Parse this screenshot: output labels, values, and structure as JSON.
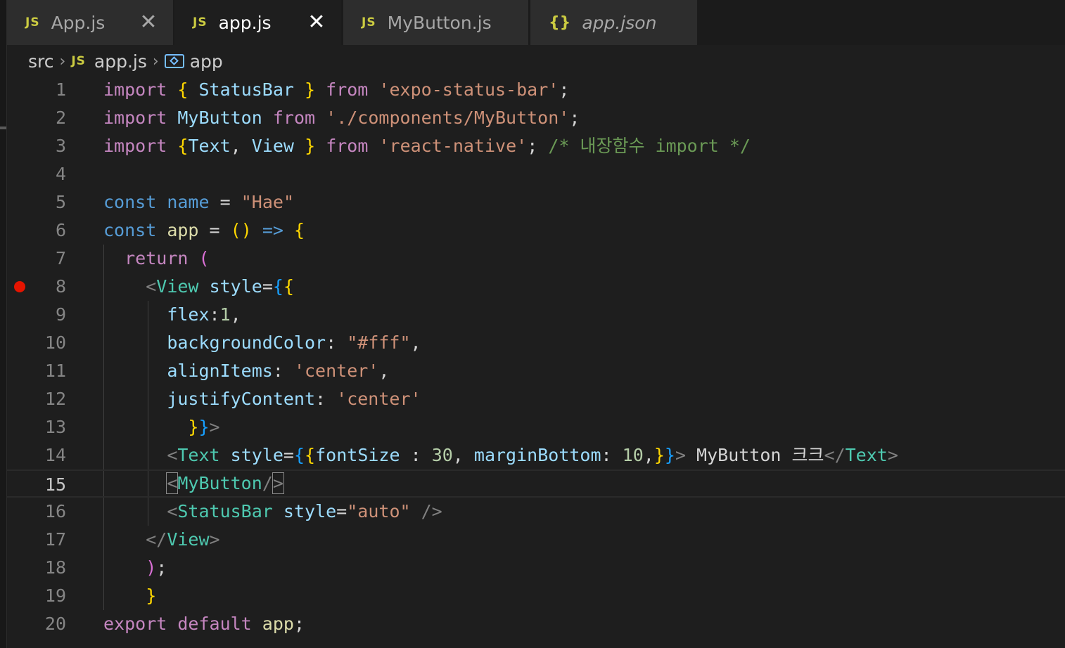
{
  "tabs": [
    {
      "icon": "JS",
      "label": "App.js",
      "close": "✕"
    },
    {
      "icon": "JS",
      "label": "app.js",
      "close": "✕"
    },
    {
      "icon": "JS",
      "label": "MyButton.js"
    },
    {
      "icon": "{}",
      "label": "app.json"
    }
  ],
  "breadcrumb": {
    "folder": "src",
    "file_icon": "JS",
    "file": "app.js",
    "symbol": "app"
  },
  "gutter": [
    "1",
    "2",
    "3",
    "4",
    "5",
    "6",
    "7",
    "8",
    "9",
    "10",
    "11",
    "12",
    "13",
    "14",
    "15",
    "16",
    "17",
    "18",
    "19",
    "20"
  ],
  "current_line": "15",
  "breakpoint_line": "8",
  "colors": {
    "background": "#1e1e1e",
    "keyword": "#c586c0",
    "string": "#ce9178",
    "tag": "#4ec9b0",
    "breakpoint": "#e51400"
  },
  "code": {
    "l1": {
      "import": "import",
      "ob": "{",
      "name": "StatusBar",
      "cb": "}",
      "from": "from",
      "src": "'expo-status-bar'",
      "semi": ";"
    },
    "l2": {
      "import": "import",
      "name": "MyButton",
      "from": "from",
      "src": "'./components/MyButton'",
      "semi": ";"
    },
    "l3": {
      "import": "import",
      "ob": "{",
      "n1": "Text",
      "comma": ",",
      "n2": "View",
      "cb": "}",
      "from": "from",
      "src": "'react-native'",
      "semi": ";",
      "comment": "/* 내장함수 import */"
    },
    "l5": {
      "const": "const",
      "name": "name",
      "eq": "=",
      "val": "\"Hae\""
    },
    "l6": {
      "const": "const",
      "name": "app",
      "eq": "=",
      "parens": "()",
      "arrow": "=>",
      "ob": "{"
    },
    "l7": {
      "ret": "return",
      "op": "("
    },
    "l8": {
      "lt": "<",
      "tag": "View",
      "attr": "style",
      "eq": "=",
      "ob1": "{",
      "ob2": "{"
    },
    "l9": {
      "key": "flex",
      "colon": ":",
      "val": "1",
      "comma": ","
    },
    "l10": {
      "key": "backgroundColor",
      "colon": ":",
      "val": "\"#fff\"",
      "comma": ","
    },
    "l11": {
      "key": "alignItems",
      "colon": ":",
      "val": "'center'",
      "comma": ","
    },
    "l12": {
      "key": "justifyContent",
      "colon": ":",
      "val": "'center'"
    },
    "l13": {
      "cb2": "}",
      "cb1": "}",
      "gt": ">"
    },
    "l14": {
      "lt": "<",
      "tag": "Text",
      "attr": "style",
      "eq": "=",
      "ob1": "{",
      "ob2": "{",
      "k1": "fontSize",
      "c1": " : ",
      "v1": "30",
      "comma1": ", ",
      "k2": "marginBottom",
      "c2": ": ",
      "v2": "10",
      "comma2": ",",
      "cb2": "}",
      "cb1": "}",
      "gt": ">",
      "content": " MyButton 크크",
      "close_lt": "</",
      "close_tag": "Text",
      "close_gt": ">"
    },
    "l15": {
      "lt": "<",
      "tag": "MyButton",
      "slash": "/",
      "gt": ">"
    },
    "l16": {
      "lt": "<",
      "tag": "StatusBar",
      "attr": "style",
      "eq": "=",
      "val": "\"auto\"",
      "end": " />"
    },
    "l17": {
      "lt": "</",
      "tag": "View",
      "gt": ">"
    },
    "l18": {
      "cp": ")",
      "semi": ";"
    },
    "l19": {
      "cb": "}"
    },
    "l20": {
      "export": "export",
      "default": "default",
      "name": "app",
      "semi": ";"
    }
  }
}
